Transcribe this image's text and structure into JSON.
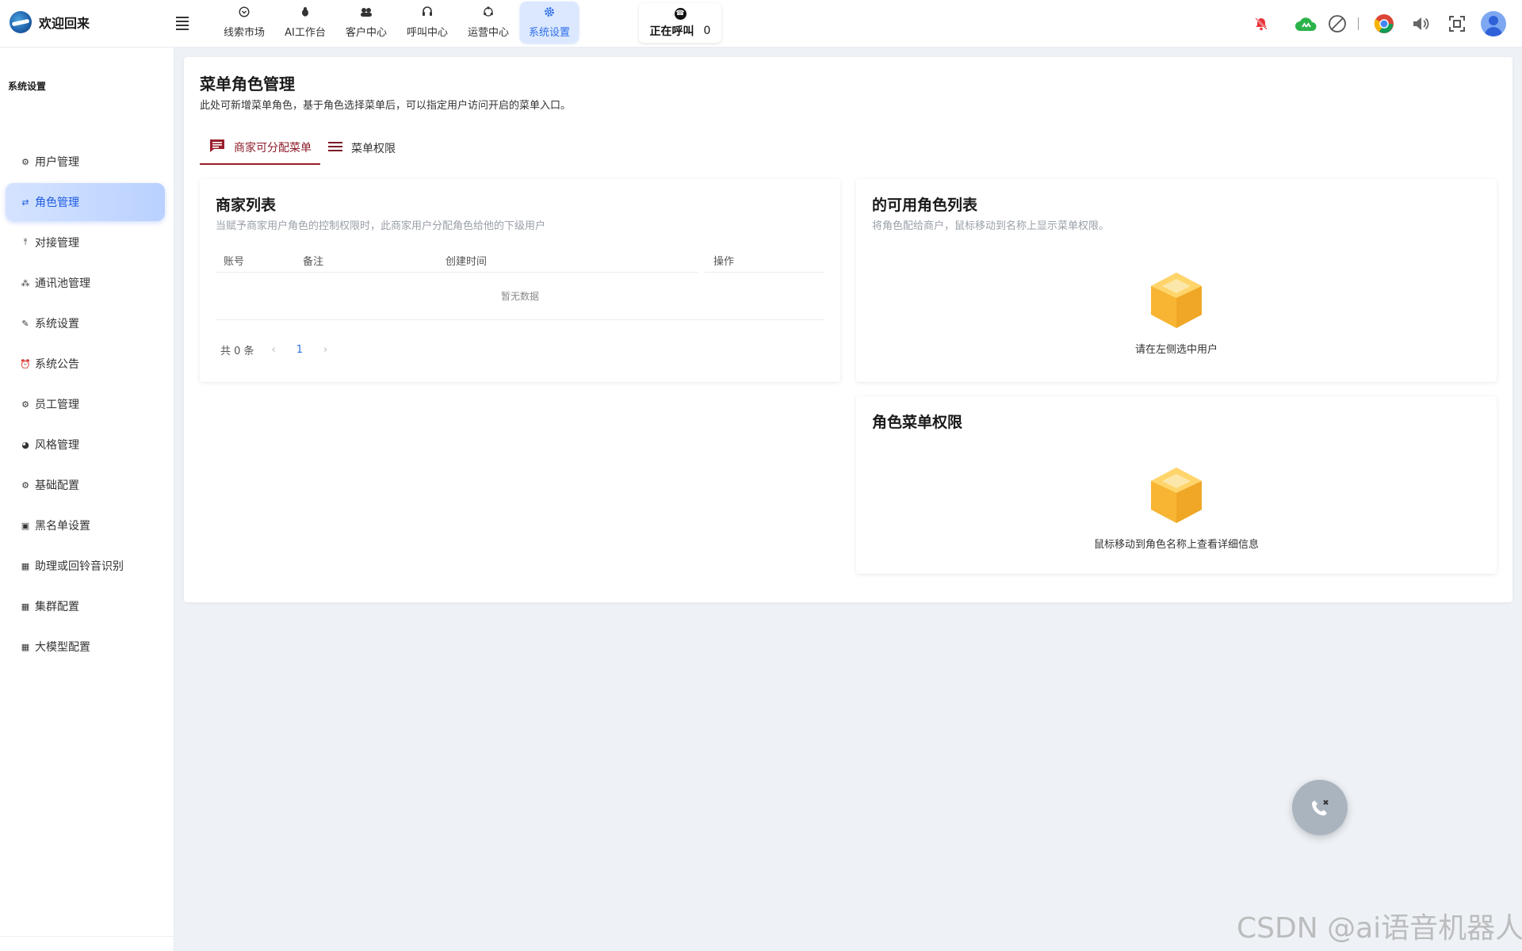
{
  "app": {
    "title": "欢迎回来"
  },
  "nav": {
    "items": [
      {
        "label": "线索市场",
        "icon": "chevron-circle-icon"
      },
      {
        "label": "AI工作台",
        "icon": "bug-icon"
      },
      {
        "label": "客户中心",
        "icon": "users-icon"
      },
      {
        "label": "呼叫中心",
        "icon": "headset-icon"
      },
      {
        "label": "运营中心",
        "icon": "share-icon"
      },
      {
        "label": "系统设置",
        "icon": "gear-icon"
      }
    ],
    "active": "系统设置"
  },
  "calling": {
    "label": "正在呼叫",
    "count": "0"
  },
  "toolbar": {
    "icons": [
      "bell-off-icon",
      "cloud-upload-icon",
      "block-icon",
      "chrome-icon",
      "volume-icon",
      "fullscreen-icon",
      "avatar-icon"
    ]
  },
  "sidebar": {
    "title": "系统设置",
    "items": [
      {
        "label": "用户管理",
        "icon": "gear-icon"
      },
      {
        "label": "角色管理",
        "icon": "switch-icon"
      },
      {
        "label": "对接管理",
        "icon": "merge-icon"
      },
      {
        "label": "通讯池管理",
        "icon": "network-icon"
      },
      {
        "label": "系统设置",
        "icon": "wrench-icon"
      },
      {
        "label": "系统公告",
        "icon": "alarm-icon"
      },
      {
        "label": "员工管理",
        "icon": "gear-icon"
      },
      {
        "label": "风格管理",
        "icon": "palette-icon"
      },
      {
        "label": "基础配置",
        "icon": "gear-icon"
      },
      {
        "label": "黑名单设置",
        "icon": "contact-icon"
      },
      {
        "label": "助理或回铃音识别",
        "icon": "grid-icon"
      },
      {
        "label": "集群配置",
        "icon": "grid-icon"
      },
      {
        "label": "大模型配置",
        "icon": "grid-icon"
      }
    ],
    "active": "角色管理"
  },
  "page": {
    "title": "菜单角色管理",
    "description": "此处可新增菜单角色，基于角色选择菜单后，可以指定用户访问开启的菜单入口。",
    "tabs": [
      {
        "label": "商家可分配菜单",
        "icon": "message-icon"
      },
      {
        "label": "菜单权限",
        "icon": "menu-lines-icon"
      }
    ]
  },
  "merchants": {
    "title": "商家列表",
    "subtitle": "当赋予商家用户角色的控制权限时，此商家用户分配角色给他的下级用户",
    "columns": [
      "账号",
      "备注",
      "创建时间",
      "操作"
    ],
    "rows": [],
    "empty_text": "暂无数据",
    "pagination": {
      "total_text": "共 0 条",
      "current_page": "1",
      "prev": "‹",
      "next": "›"
    }
  },
  "roles": {
    "title": "的可用角色列表",
    "subtitle": "将角色配给商户，鼠标移动到名称上显示菜单权限。",
    "empty_text": "请在左侧选中用户"
  },
  "role_menu": {
    "title": "角色菜单权限",
    "empty_text": "鼠标移动到角色名称上查看详细信息"
  },
  "watermark": "CSDN @ai语音机器人",
  "colors": {
    "accent_blue": "#2f6fe8",
    "tab_red": "#9a1f2c",
    "empty_box_orange": "#f7b533",
    "background": "#eef2f6"
  }
}
